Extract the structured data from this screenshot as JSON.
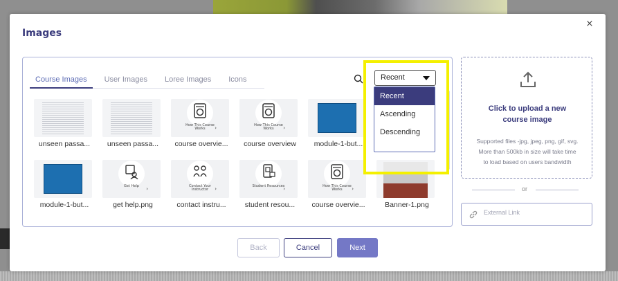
{
  "modal": {
    "title": "Images",
    "close_label": "×"
  },
  "tabs": [
    {
      "label": "Course Images",
      "active": true
    },
    {
      "label": "User Images",
      "active": false
    },
    {
      "label": "Loree Images",
      "active": false
    },
    {
      "label": "Icons",
      "active": false
    }
  ],
  "sort": {
    "selected": "Recent",
    "options": [
      "Recent",
      "Ascending",
      "Descending"
    ]
  },
  "images": [
    {
      "name": "unseen passa...",
      "kind": "document"
    },
    {
      "name": "unseen passa...",
      "kind": "document"
    },
    {
      "name": "course overvie...",
      "kind": "icon-tile",
      "tile_text": "How This Course Works"
    },
    {
      "name": "course overview",
      "kind": "icon-tile",
      "tile_text": "How This Course Works"
    },
    {
      "name": "module-1-but...",
      "kind": "blue"
    },
    {
      "name": "module-1-but...",
      "kind": "blue"
    },
    {
      "name": "get help.png",
      "kind": "icon-tile",
      "tile_text": "Get Help"
    },
    {
      "name": "contact instru...",
      "kind": "icon-tile",
      "tile_text": "Contact Your Instructor"
    },
    {
      "name": "student resou...",
      "kind": "icon-tile",
      "tile_text": "Student Resources"
    },
    {
      "name": "course overvie...",
      "kind": "icon-tile",
      "tile_text": "How This Course Works"
    },
    {
      "name": "Banner-1.png",
      "kind": "banner"
    }
  ],
  "upload": {
    "title_line1": "Click to upload a new",
    "title_line2": "course image",
    "note_line1": "Supported files -jpg, jpeg, png, gif, svg.",
    "note_line2": "More than 500kb in size will take time",
    "note_line3": "to load based on users bandwidth"
  },
  "divider_text": "or",
  "external_link": {
    "placeholder": "External Link",
    "value": ""
  },
  "footer": {
    "back": "Back",
    "cancel": "Cancel",
    "next": "Next"
  },
  "colors": {
    "brand": "#3b3c7d",
    "next_button": "#7478c6",
    "highlight": "#f4f000",
    "thumb_blue": "#1d6fb0"
  }
}
